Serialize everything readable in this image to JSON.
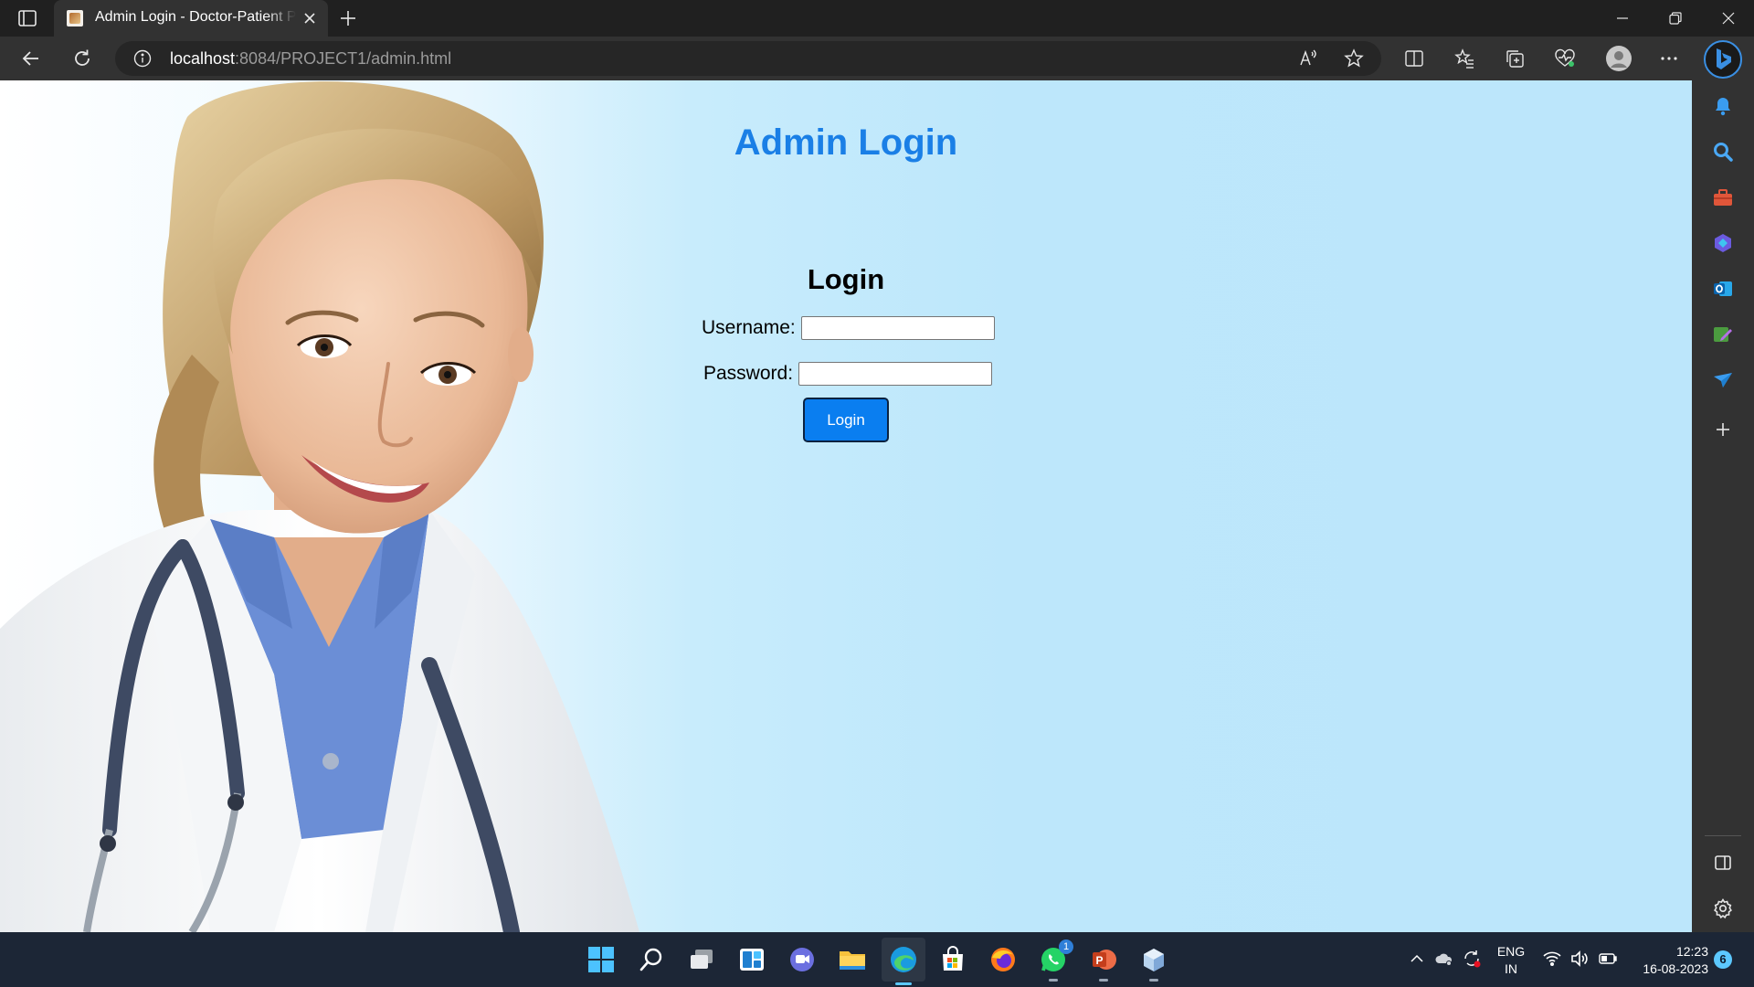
{
  "browser": {
    "tab_title": "Admin Login - Doctor-Patient Portal",
    "url_host": "localhost",
    "url_rest": ":8084/PROJECT1/admin.html"
  },
  "page": {
    "title": "Admin Login",
    "form_heading": "Login",
    "username_label": "Username:",
    "password_label": "Password:",
    "username_value": "",
    "password_value": "",
    "login_button": "Login"
  },
  "taskbar": {
    "lang_line1": "ENG",
    "lang_line2": "IN",
    "time": "12:23",
    "date": "16-08-2023",
    "notification_count": "6",
    "whatsapp_badge": "1"
  },
  "colors": {
    "title_blue": "#1a7fe6",
    "button_blue": "#0a7ef0",
    "page_bg": "#bde7fb"
  }
}
